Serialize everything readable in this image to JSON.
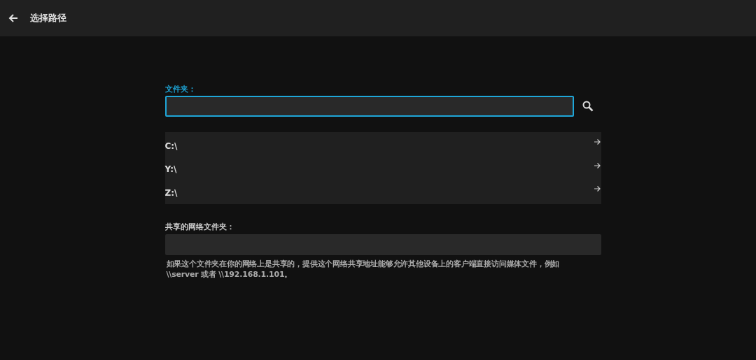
{
  "header": {
    "title": "选择路径"
  },
  "folder": {
    "label": "文件夹：",
    "focused": true
  },
  "drives": [
    {
      "label": "C:\\"
    },
    {
      "label": "Y:\\"
    },
    {
      "label": "Z:\\"
    }
  ],
  "network": {
    "label": "共享的网络文件夹：",
    "help": "如果这个文件夹在你的网络上是共享的，提供这个网络共享地址能够允许其他设备上的客户端直接访问媒体文件，例如\n\\\\server 或者 \\\\192.168.1.101。"
  }
}
